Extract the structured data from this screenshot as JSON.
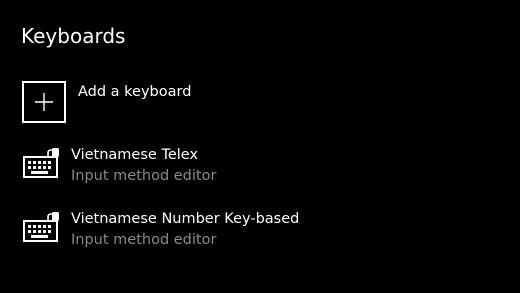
{
  "header": {
    "title": "Keyboards"
  },
  "add_keyboard": {
    "label": "Add a keyboard",
    "icon": "plus-icon"
  },
  "keyboards": [
    {
      "name": "Vietnamese Telex",
      "description": "Input method editor",
      "icon": "keyboard-icon"
    },
    {
      "name": "Vietnamese Number Key-based",
      "description": "Input method editor",
      "icon": "keyboard-icon"
    }
  ],
  "colors": {
    "background": "#000000",
    "text": "#ffffff",
    "secondary_text": "#8a8a8a"
  }
}
